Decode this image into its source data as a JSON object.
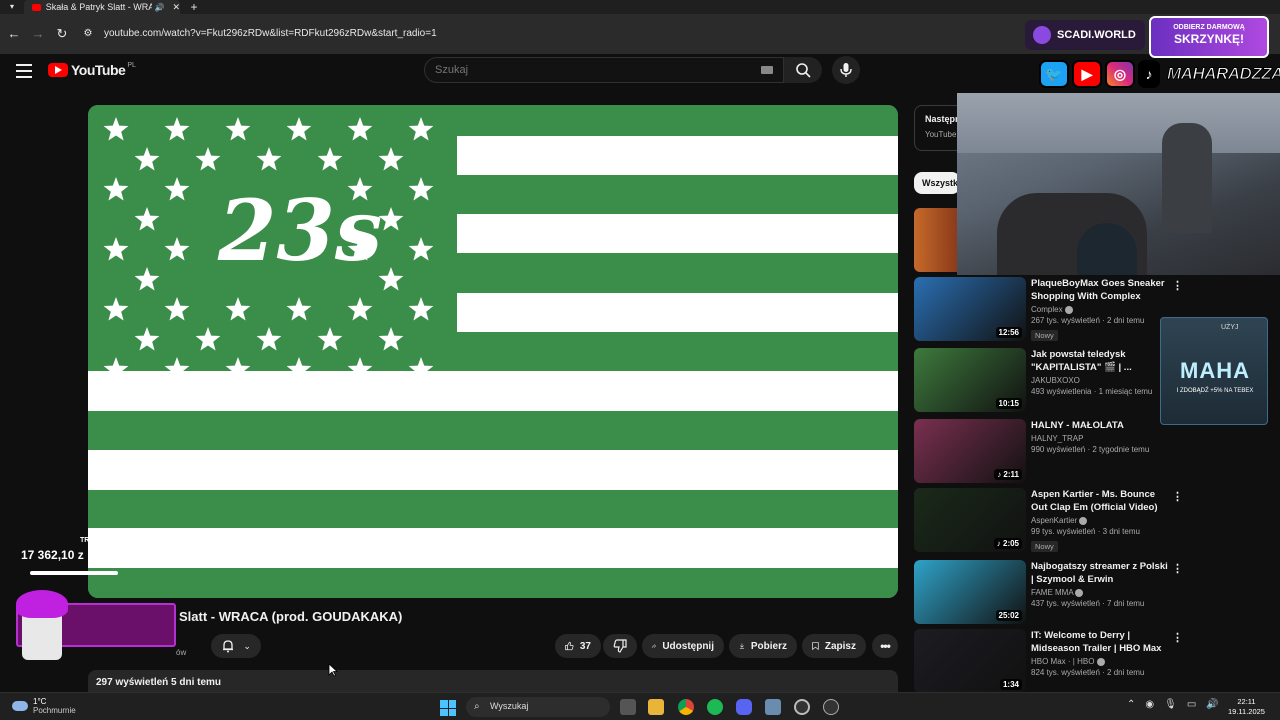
{
  "browser": {
    "tab_title": "Skała & Patryk Slatt - WRAC",
    "url": "youtube.com/watch?v=Fkut296zRDw&list=RDFkut296zRDw&start_radio=1"
  },
  "youtube": {
    "logo_text": "YouTube",
    "country_code": "PL",
    "search_placeholder": "Szukaj"
  },
  "video": {
    "title": "Slatt - WRACA (prod. GOUDAKAKA)",
    "flag_emblem": "23s",
    "subscribers_partial": "ów",
    "likes": "37",
    "share_label": "Udostępnij",
    "download_label": "Pobierz",
    "save_label": "Zapisz",
    "views_date": "297 wyświetleń  5 dni temu"
  },
  "sidebar": {
    "next_label": "Następn",
    "next_channel": "YouTube",
    "chip_all": "Wszystk",
    "recommendations": [
      {
        "title": "PlaqueBoyMax Goes Sneaker Shopping With Complex",
        "channel": "Complex",
        "verified": true,
        "stats": "267 tys. wyświetleń · 2 dni temu",
        "badge": "Nowy",
        "duration": "12:56",
        "thumb_color": "#2a6fb3"
      },
      {
        "title": "Jak powstał teledysk \"KAPITALISTA\" 🎬 | ...",
        "channel": "JAKUBXOXO",
        "verified": false,
        "stats": "493 wyświetlenia · 1 miesiąc temu",
        "badge": "",
        "duration": "10:15",
        "thumb_color": "#3d7a3d"
      },
      {
        "title": "HALNY - MAŁOLATA",
        "channel": "HALNY_TRAP",
        "verified": false,
        "stats": "990 wyświetleń · 2 tygodnie temu",
        "badge": "",
        "duration": "♪ 2:11",
        "thumb_color": "#7a3050"
      },
      {
        "title": "Aspen Kartier - Ms. Bounce Out Clap Em (Official Video)",
        "channel": "AspenKartier",
        "verified": true,
        "stats": "99 tys. wyświetleń · 3 dni temu",
        "badge": "Nowy",
        "duration": "♪ 2:05",
        "thumb_color": "#1a2a1a"
      },
      {
        "title": "Najbogatszy streamer z Polski | Szymool & Erwin",
        "channel": "FAME MMA",
        "verified": true,
        "stats": "437 tys. wyświetleń · 7 dni temu",
        "badge": "",
        "duration": "25:02",
        "thumb_color": "#2fa3c9"
      },
      {
        "title": "IT: Welcome to Derry | Midseason Trailer | HBO Max",
        "channel": "HBO Max · | HBO",
        "verified": true,
        "stats": "824 tys. wyświetleń · 2 dni temu",
        "badge": "",
        "duration": "1:34",
        "thumb_color": "#1c1c22"
      }
    ]
  },
  "stream_overlay": {
    "brand": "SCADI.WORLD",
    "promo_top": "ODBIERZ DARMOWĄ",
    "promo_main": "SKRZYNKĘ!",
    "handle": "MAHARADZZA",
    "promo_code_use": "UŻYJ",
    "promo_code": "MAHA",
    "promo_code_sub": "I ZDOBĄDŹ +5% NA TEBEX",
    "donation_label": "TRZECI OSTATNI",
    "donation_value": "17 362,10 z"
  },
  "taskbar": {
    "temperature": "1°C",
    "weather": "Pochmurnie",
    "search": "Wyszukaj",
    "time": "22:11",
    "date": "19.11.2025"
  },
  "colors": {
    "flag_green": "#3a8e4a",
    "youtube_red": "#ff0000",
    "page_bg": "#0f0f0f"
  }
}
